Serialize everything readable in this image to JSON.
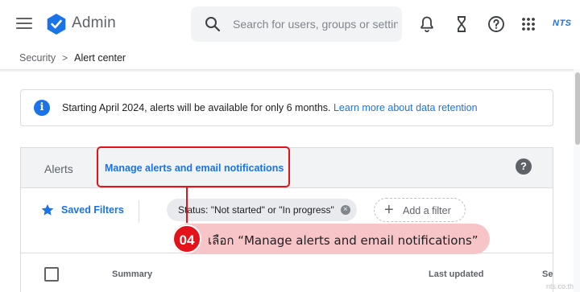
{
  "header": {
    "app_title": "Admin",
    "search_placeholder": "Search for users, groups or settings",
    "brand_label": "NTS"
  },
  "breadcrumb": {
    "items": [
      "Security",
      "Alert center"
    ],
    "separator": ">"
  },
  "banner": {
    "text": "Starting April 2024, alerts will be available for only 6 months. ",
    "link": "Learn more about data retention"
  },
  "alerts_card": {
    "title": "Alerts",
    "manage_link": "Manage alerts and email notifications",
    "help": "?"
  },
  "filters": {
    "saved_filters_label": "Saved Filters",
    "active_chip": "Status: \"Not started\" or \"In progress\"",
    "add_filter_label": "Add a filter"
  },
  "table": {
    "columns": [
      "Summary",
      "Last updated",
      "Se"
    ]
  },
  "annotation": {
    "step": "04",
    "text": "เลือก “Manage alerts and email notifications”"
  },
  "watermark": "nts.co.th",
  "colors": {
    "accent": "#1a73e8",
    "annotation_red": "#e3121b",
    "annotation_pink": "#f7c5c8"
  }
}
